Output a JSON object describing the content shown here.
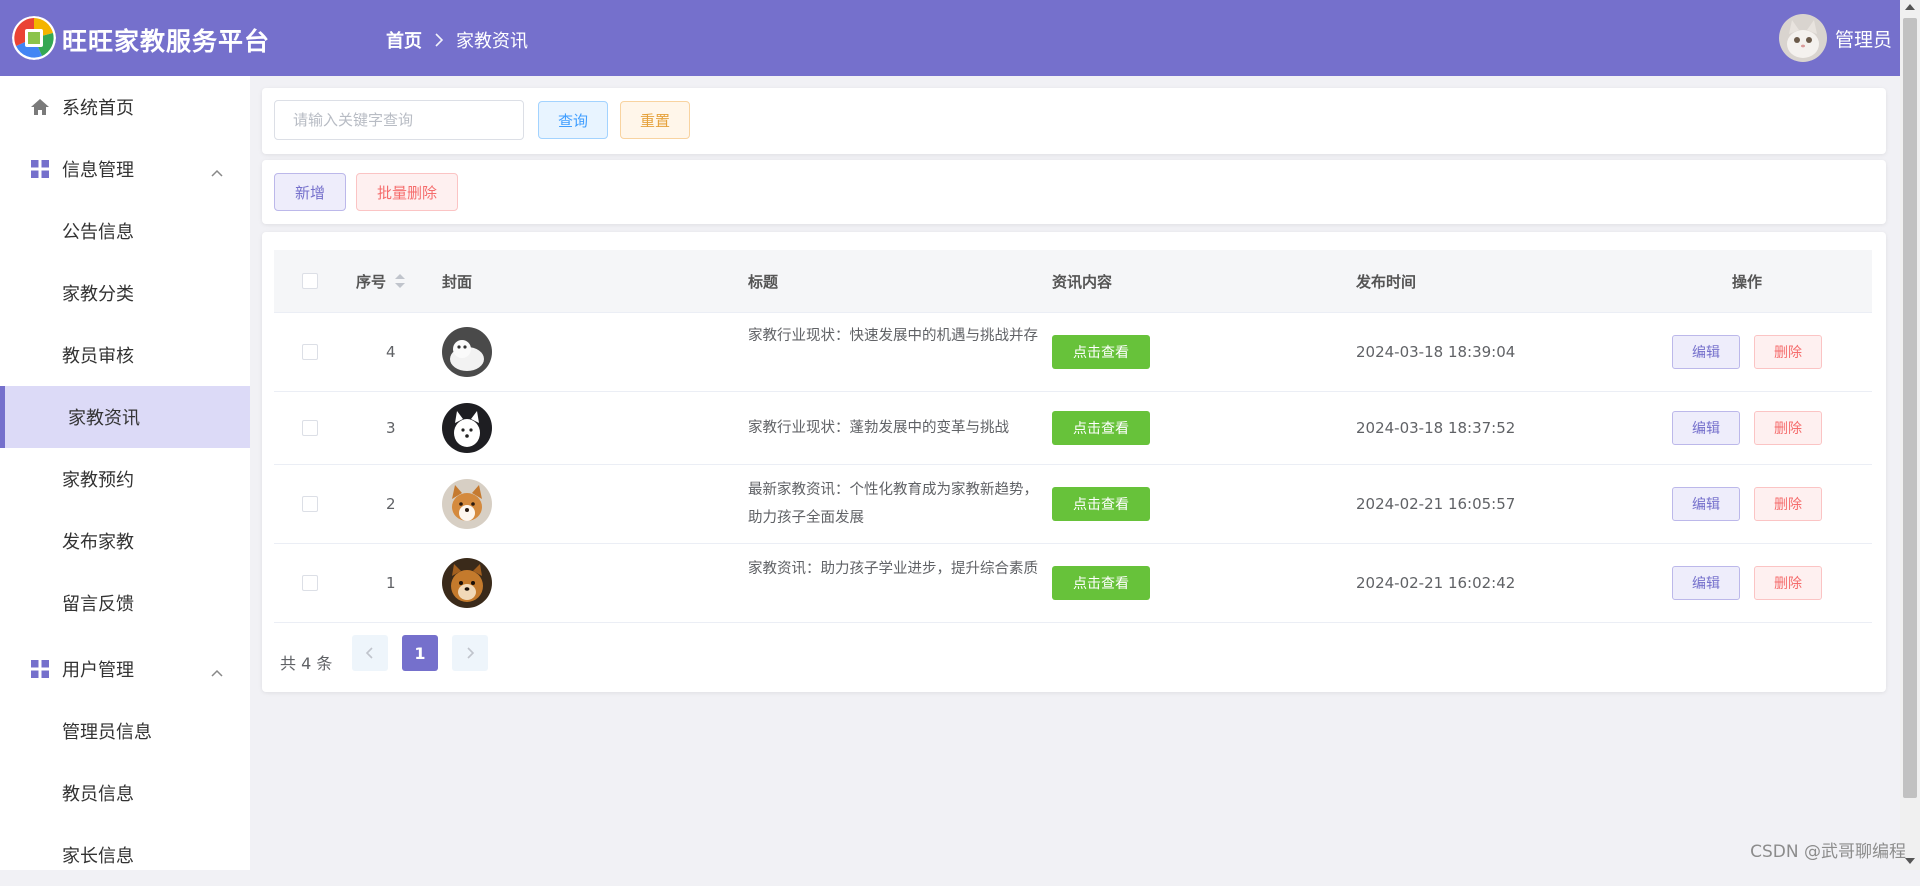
{
  "header": {
    "brand": "旺旺家教服务平台",
    "breadcrumb_home": "首页",
    "breadcrumb_current": "家教资讯",
    "user_name": "管理员",
    "bg_color": "#7570cc"
  },
  "sidebar": {
    "home": "系统首页",
    "group_info": "信息管理",
    "info_items": [
      "公告信息",
      "家教分类",
      "教员审核",
      "家教资讯",
      "家教预约",
      "发布家教",
      "留言反馈"
    ],
    "active_item": "家教资讯",
    "group_user": "用户管理",
    "user_items": [
      "管理员信息",
      "教员信息",
      "家长信息"
    ]
  },
  "search": {
    "placeholder": "请输入关键字查询",
    "query_label": "查询",
    "reset_label": "重置"
  },
  "toolbar": {
    "add_label": "新增",
    "batch_delete_label": "批量删除"
  },
  "table": {
    "headers": {
      "index": "序号",
      "cover": "封面",
      "title": "标题",
      "content": "资讯内容",
      "time": "发布时间",
      "actions": "操作"
    },
    "rows": [
      {
        "id": "4",
        "title": "家教行业现状：快速发展中的机遇与挑战并存",
        "view": "点击查看",
        "time": "2024-03-18 18:39:04",
        "edit": "编辑",
        "delete": "删除"
      },
      {
        "id": "3",
        "title": "家教行业现状：蓬勃发展中的变革与挑战",
        "view": "点击查看",
        "time": "2024-03-18 18:37:52",
        "edit": "编辑",
        "delete": "删除"
      },
      {
        "id": "2",
        "title": "最新家教资讯：个性化教育成为家教新趋势，助力孩子全面发展",
        "view": "点击查看",
        "time": "2024-02-21 16:05:57",
        "edit": "编辑",
        "delete": "删除"
      },
      {
        "id": "1",
        "title": "家教资讯：助力孩子学业进步，提升综合素质",
        "view": "点击查看",
        "time": "2024-02-21 16:02:42",
        "edit": "编辑",
        "delete": "删除"
      }
    ]
  },
  "pagination": {
    "total": "共 4 条",
    "current_page": "1"
  },
  "watermark": "CSDN @武哥聊编程"
}
